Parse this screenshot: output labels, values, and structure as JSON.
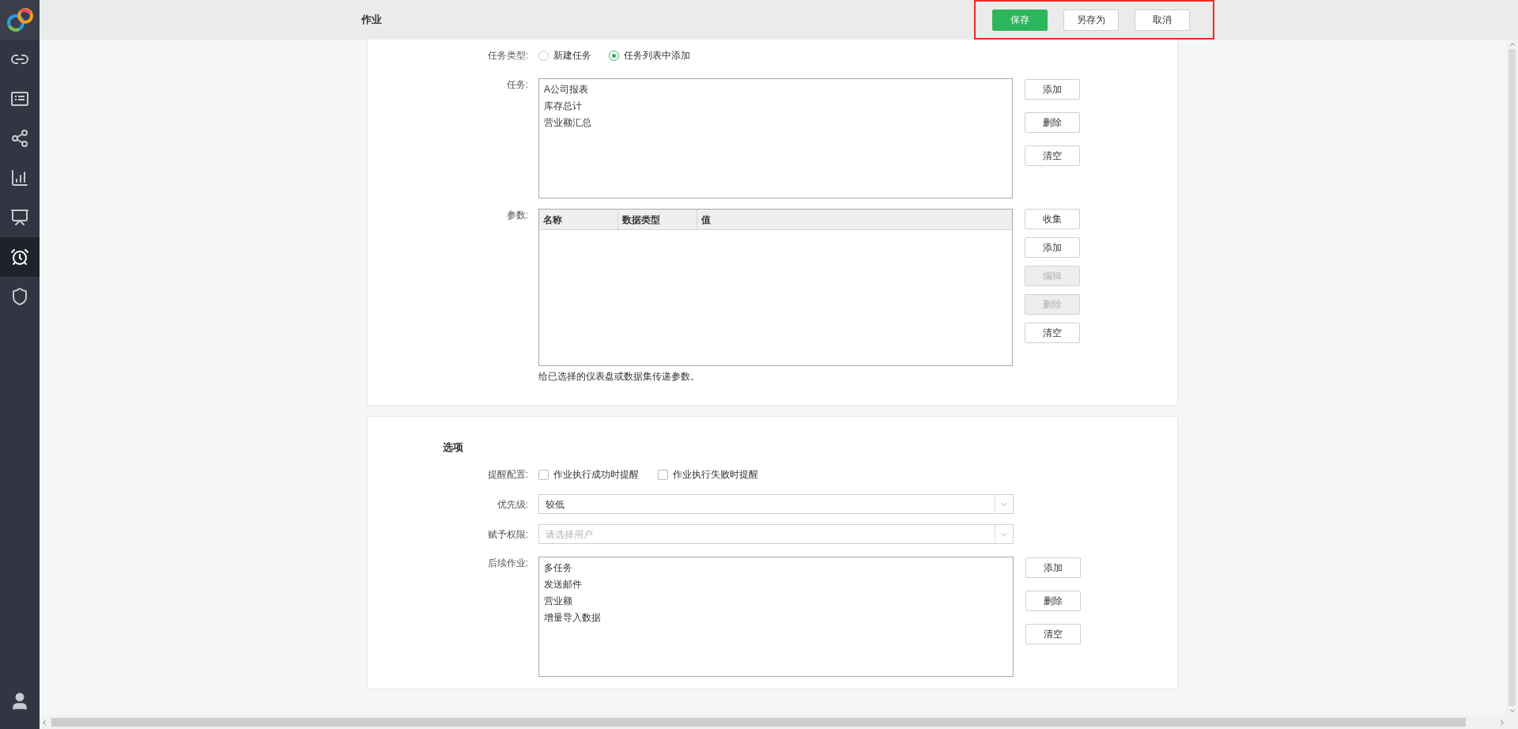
{
  "nav": [
    {
      "selected": false
    },
    {
      "selected": false
    },
    {
      "selected": false
    },
    {
      "selected": false
    },
    {
      "selected": false
    },
    {
      "selected": false
    },
    {
      "selected": true
    },
    {
      "selected": false
    },
    {
      "selected": false
    }
  ],
  "header": {
    "title": "作业",
    "buttons": [
      {
        "label": "保存",
        "kind": "primary"
      },
      {
        "label": "另存为",
        "kind": "default"
      },
      {
        "label": "取消",
        "kind": "default"
      }
    ]
  },
  "task_type": {
    "label": "任务类型:",
    "options": [
      {
        "label": "新建任务",
        "selected": false
      },
      {
        "label": "任务列表中添加",
        "selected": true
      }
    ]
  },
  "tasks": {
    "label": "任务:",
    "items": [
      "A公司报表",
      "库存总计",
      "营业额汇总"
    ],
    "buttons": [
      {
        "label": "添加",
        "disabled": false
      },
      {
        "label": "删除",
        "disabled": false
      },
      {
        "label": "清空",
        "disabled": false
      }
    ]
  },
  "params": {
    "label": "参数:",
    "columns": [
      "名称",
      "数据类型",
      "值"
    ],
    "buttons": [
      {
        "label": "收集",
        "disabled": false
      },
      {
        "label": "添加",
        "disabled": false
      },
      {
        "label": "编辑",
        "disabled": true
      },
      {
        "label": "删除",
        "disabled": true
      },
      {
        "label": "清空",
        "disabled": false
      }
    ],
    "hint": "给已选择的仪表盘或数据集传递参数。"
  },
  "options": {
    "title": "选项",
    "reminder": {
      "label": "提醒配置:",
      "checkboxes": [
        {
          "label": "作业执行成功时提醒",
          "checked": false
        },
        {
          "label": "作业执行失败时提醒",
          "checked": false
        }
      ]
    },
    "priority": {
      "label": "优先级:",
      "value": "较低"
    },
    "permission": {
      "label": "赋予权限:",
      "placeholder": "请选择用户"
    },
    "followups": {
      "label": "后续作业:",
      "items": [
        "多任务",
        "发送邮件",
        "营业额",
        "增量导入数据"
      ],
      "buttons": [
        {
          "label": "添加",
          "disabled": false
        },
        {
          "label": "删除",
          "disabled": false
        },
        {
          "label": "清空",
          "disabled": false
        }
      ]
    }
  }
}
